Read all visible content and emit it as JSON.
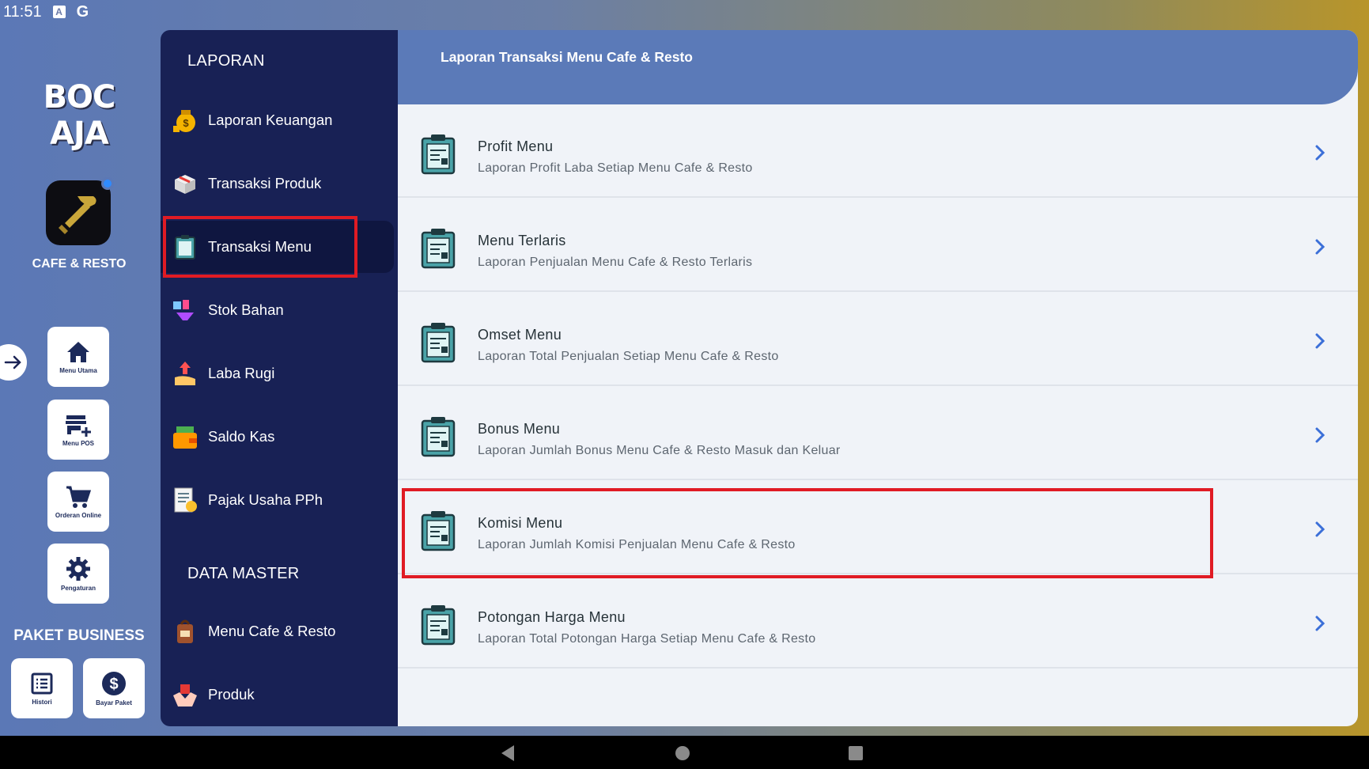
{
  "status_bar": {
    "time": "11:51",
    "icon_a": "A",
    "icon_g": "G"
  },
  "brand": {
    "logo_text": "BOC AJA",
    "app_label": "CAFE & RESTO"
  },
  "quick_tiles": [
    {
      "label": "Menu Utama",
      "icon": "home-icon"
    },
    {
      "label": "Menu POS",
      "icon": "store-add-icon"
    },
    {
      "label": "Orderan Online",
      "icon": "cart-icon"
    },
    {
      "label": "Pengaturan",
      "icon": "gear-icon"
    }
  ],
  "paket": {
    "title": "PAKET BUSINESS",
    "tiles": [
      {
        "label": "Histori",
        "icon": "list-icon"
      },
      {
        "label": "Bayar Paket",
        "icon": "dollar-icon"
      }
    ]
  },
  "sidebar": {
    "section_laporan": "LAPORAN",
    "section_master": "DATA MASTER",
    "items": [
      {
        "label": "Laporan Keuangan",
        "icon": "money-bag-icon"
      },
      {
        "label": "Transaksi Produk",
        "icon": "box-icon"
      },
      {
        "label": "Transaksi Menu",
        "icon": "menu-board-icon",
        "active": true
      },
      {
        "label": "Stok Bahan",
        "icon": "ingredients-icon"
      },
      {
        "label": "Laba Rugi",
        "icon": "profit-hand-icon"
      },
      {
        "label": "Saldo Kas",
        "icon": "wallet-icon"
      },
      {
        "label": "Pajak Usaha PPh",
        "icon": "tax-doc-icon"
      },
      {
        "label": "Menu Cafe & Resto",
        "icon": "menu-bag-icon"
      },
      {
        "label": "Produk",
        "icon": "product-hands-icon"
      }
    ]
  },
  "content": {
    "header_title": "Laporan Transaksi Menu Cafe & Resto",
    "rows": [
      {
        "title": "Profit Menu",
        "subtitle": "Laporan Profit Laba Setiap Menu Cafe & Resto"
      },
      {
        "title": "Menu Terlaris",
        "subtitle": "Laporan Penjualan Menu Cafe & Resto Terlaris"
      },
      {
        "title": "Omset Menu",
        "subtitle": "Laporan Total Penjualan Setiap Menu Cafe & Resto"
      },
      {
        "title": "Bonus Menu",
        "subtitle": "Laporan Jumlah Bonus Menu Cafe & Resto Masuk dan Keluar"
      },
      {
        "title": "Komisi Menu",
        "subtitle": "Laporan Jumlah Komisi Penjualan Menu Cafe & Resto",
        "highlighted": true
      },
      {
        "title": "Potongan Harga Menu",
        "subtitle": "Laporan Total Potongan Harga Setiap Menu Cafe & Resto"
      }
    ]
  },
  "colors": {
    "sidebar_bg": "#182155",
    "header_bg": "#5b7ab8",
    "highlight": "#e01b24",
    "chevron": "#3b6fd8"
  }
}
